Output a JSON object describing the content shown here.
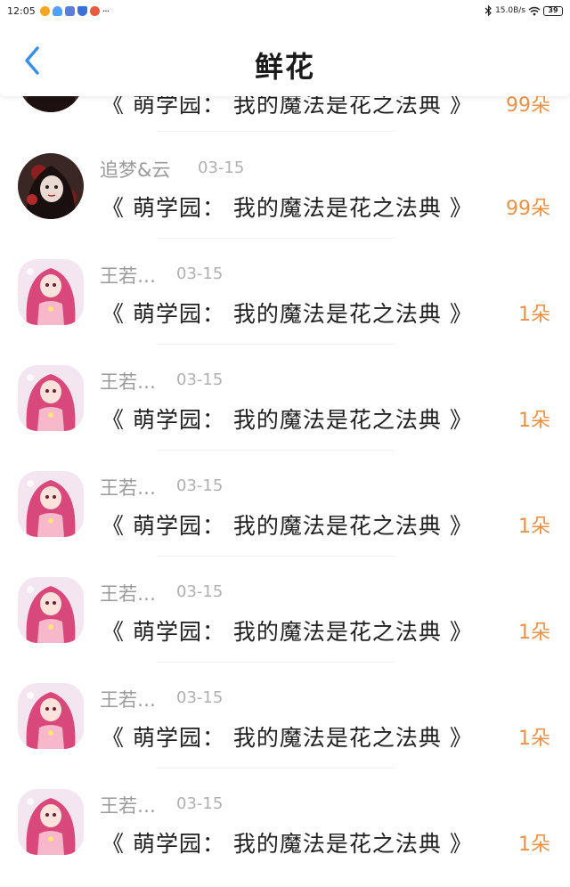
{
  "status_bar": {
    "time": "12:05",
    "more": "···",
    "network_speed": "15.0B/s",
    "battery": "39"
  },
  "header": {
    "title": "鲜花",
    "back_icon": "chevron-left-icon",
    "accent_color": "#3a8ee6"
  },
  "colors": {
    "count": "#e8914a",
    "name": "#9a9a9a",
    "date": "#b0b0b0"
  },
  "partial_row": {
    "book_title": "《 萌学园： 我的魔法是花之法典 》",
    "count": "99朵"
  },
  "entries": [
    {
      "user": "追梦&云",
      "date": "03-15",
      "book_title": "《 萌学园： 我的魔法是花之法典 》",
      "count": "99朵",
      "avatar": "dark-portrait"
    },
    {
      "user": "王若…",
      "date": "03-15",
      "book_title": "《 萌学园： 我的魔法是花之法典 》",
      "count": "1朵",
      "avatar": "pink-anime-girl"
    },
    {
      "user": "王若…",
      "date": "03-15",
      "book_title": "《 萌学园： 我的魔法是花之法典 》",
      "count": "1朵",
      "avatar": "pink-anime-girl"
    },
    {
      "user": "王若…",
      "date": "03-15",
      "book_title": "《 萌学园： 我的魔法是花之法典 》",
      "count": "1朵",
      "avatar": "pink-anime-girl"
    },
    {
      "user": "王若…",
      "date": "03-15",
      "book_title": "《 萌学园： 我的魔法是花之法典 》",
      "count": "1朵",
      "avatar": "pink-anime-girl"
    },
    {
      "user": "王若…",
      "date": "03-15",
      "book_title": "《 萌学园： 我的魔法是花之法典 》",
      "count": "1朵",
      "avatar": "pink-anime-girl"
    },
    {
      "user": "王若…",
      "date": "03-15",
      "book_title": "《 萌学园： 我的魔法是花之法典 》",
      "count": "1朵",
      "avatar": "pink-anime-girl"
    }
  ]
}
